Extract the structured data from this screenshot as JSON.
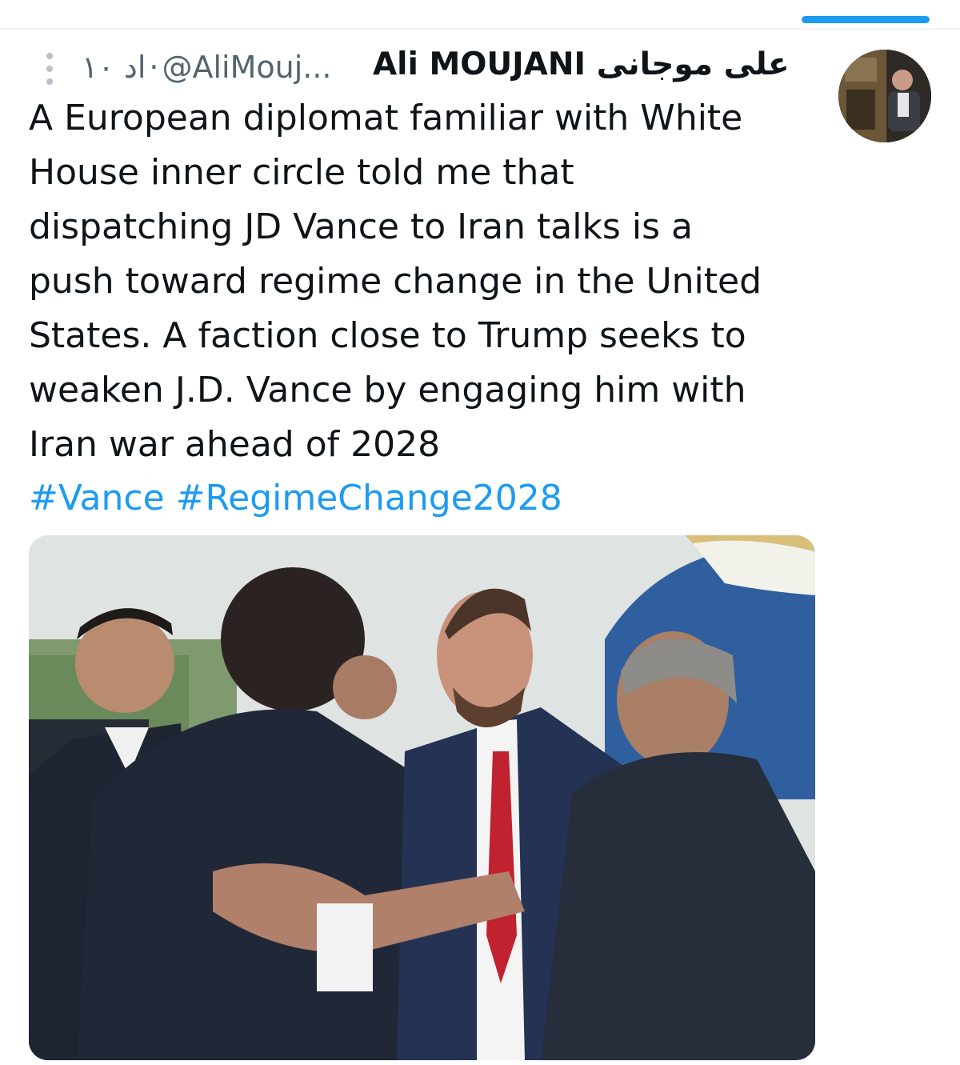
{
  "tweet": {
    "author_name": "Ali MOUJANI علی موجانی",
    "handle": "@AliMouj...",
    "separator": "·",
    "time_ago": "۱۰ اد",
    "body": "A European diplomat familiar with White\nHouse inner circle told me that\ndispatching JD Vance to Iran talks is a\npush toward regime change in the United\nStates. A faction close to Trump seeks to\nweaken J.D. Vance by engaging him with\nIran war ahead of 2028",
    "hashtags": [
      "#Vance",
      "#RegimeChange2028"
    ]
  },
  "icons": {
    "more": "vertical-dots-icon",
    "avatar": "profile-photo"
  },
  "colors": {
    "link": "#1d9bf0",
    "text": "#0f1419",
    "secondary": "#536471",
    "accent_bar": "#1d9bf0"
  }
}
